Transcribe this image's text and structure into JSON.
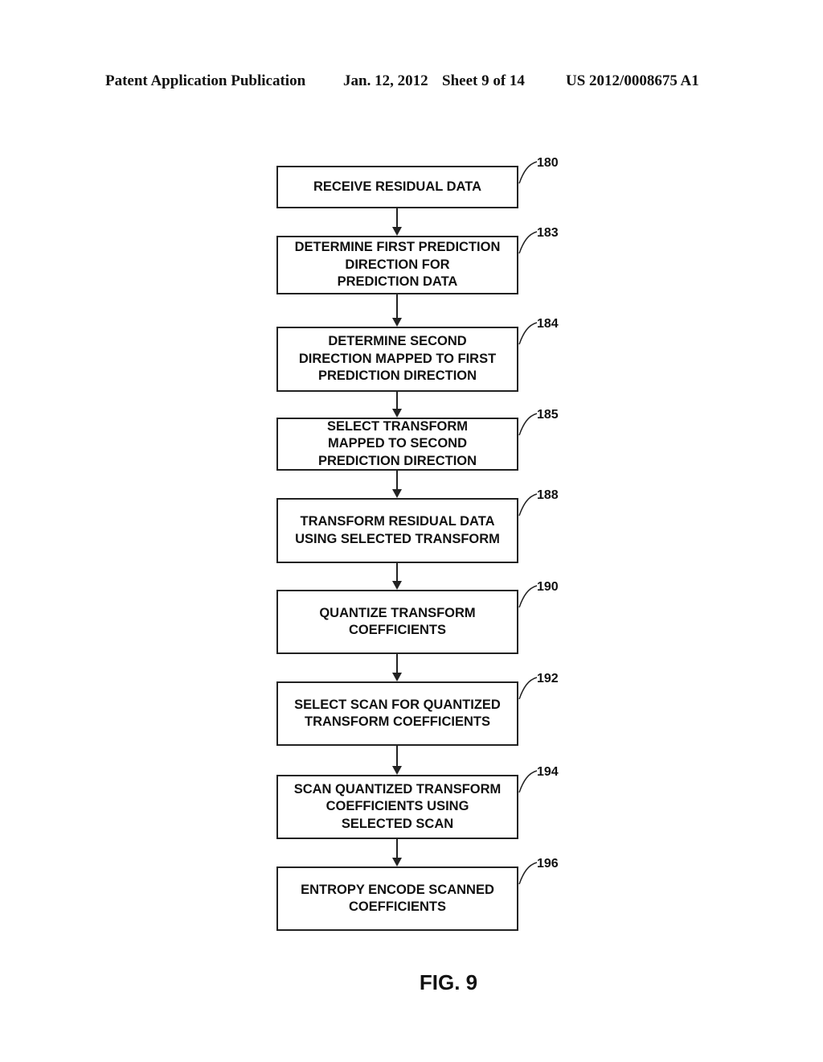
{
  "header": {
    "publication": "Patent Application Publication",
    "date": "Jan. 12, 2012",
    "sheet": "Sheet 9 of 14",
    "number": "US 2012/0008675 A1"
  },
  "flowchart": {
    "steps": [
      {
        "ref": "180",
        "text": "RECEIVE RESIDUAL DATA"
      },
      {
        "ref": "183",
        "text": "DETERMINE FIRST PREDICTION\nDIRECTION FOR\nPREDICTION DATA"
      },
      {
        "ref": "184",
        "text": "DETERMINE SECOND\nDIRECTION MAPPED TO FIRST\nPREDICTION DIRECTION"
      },
      {
        "ref": "185",
        "text": "SELECT TRANSFORM\nMAPPED TO SECOND\nPREDICTION DIRECTION"
      },
      {
        "ref": "188",
        "text": "TRANSFORM RESIDUAL DATA\nUSING SELECTED TRANSFORM"
      },
      {
        "ref": "190",
        "text": "QUANTIZE TRANSFORM\nCOEFFICIENTS"
      },
      {
        "ref": "192",
        "text": "SELECT SCAN FOR QUANTIZED\nTRANSFORM COEFFICIENTS"
      },
      {
        "ref": "194",
        "text": "SCAN QUANTIZED TRANSFORM\nCOEFFICIENTS USING\nSELECTED SCAN"
      },
      {
        "ref": "196",
        "text": "ENTROPY ENCODE SCANNED\nCOEFFICIENTS"
      }
    ]
  },
  "figure_label": "FIG. 9"
}
